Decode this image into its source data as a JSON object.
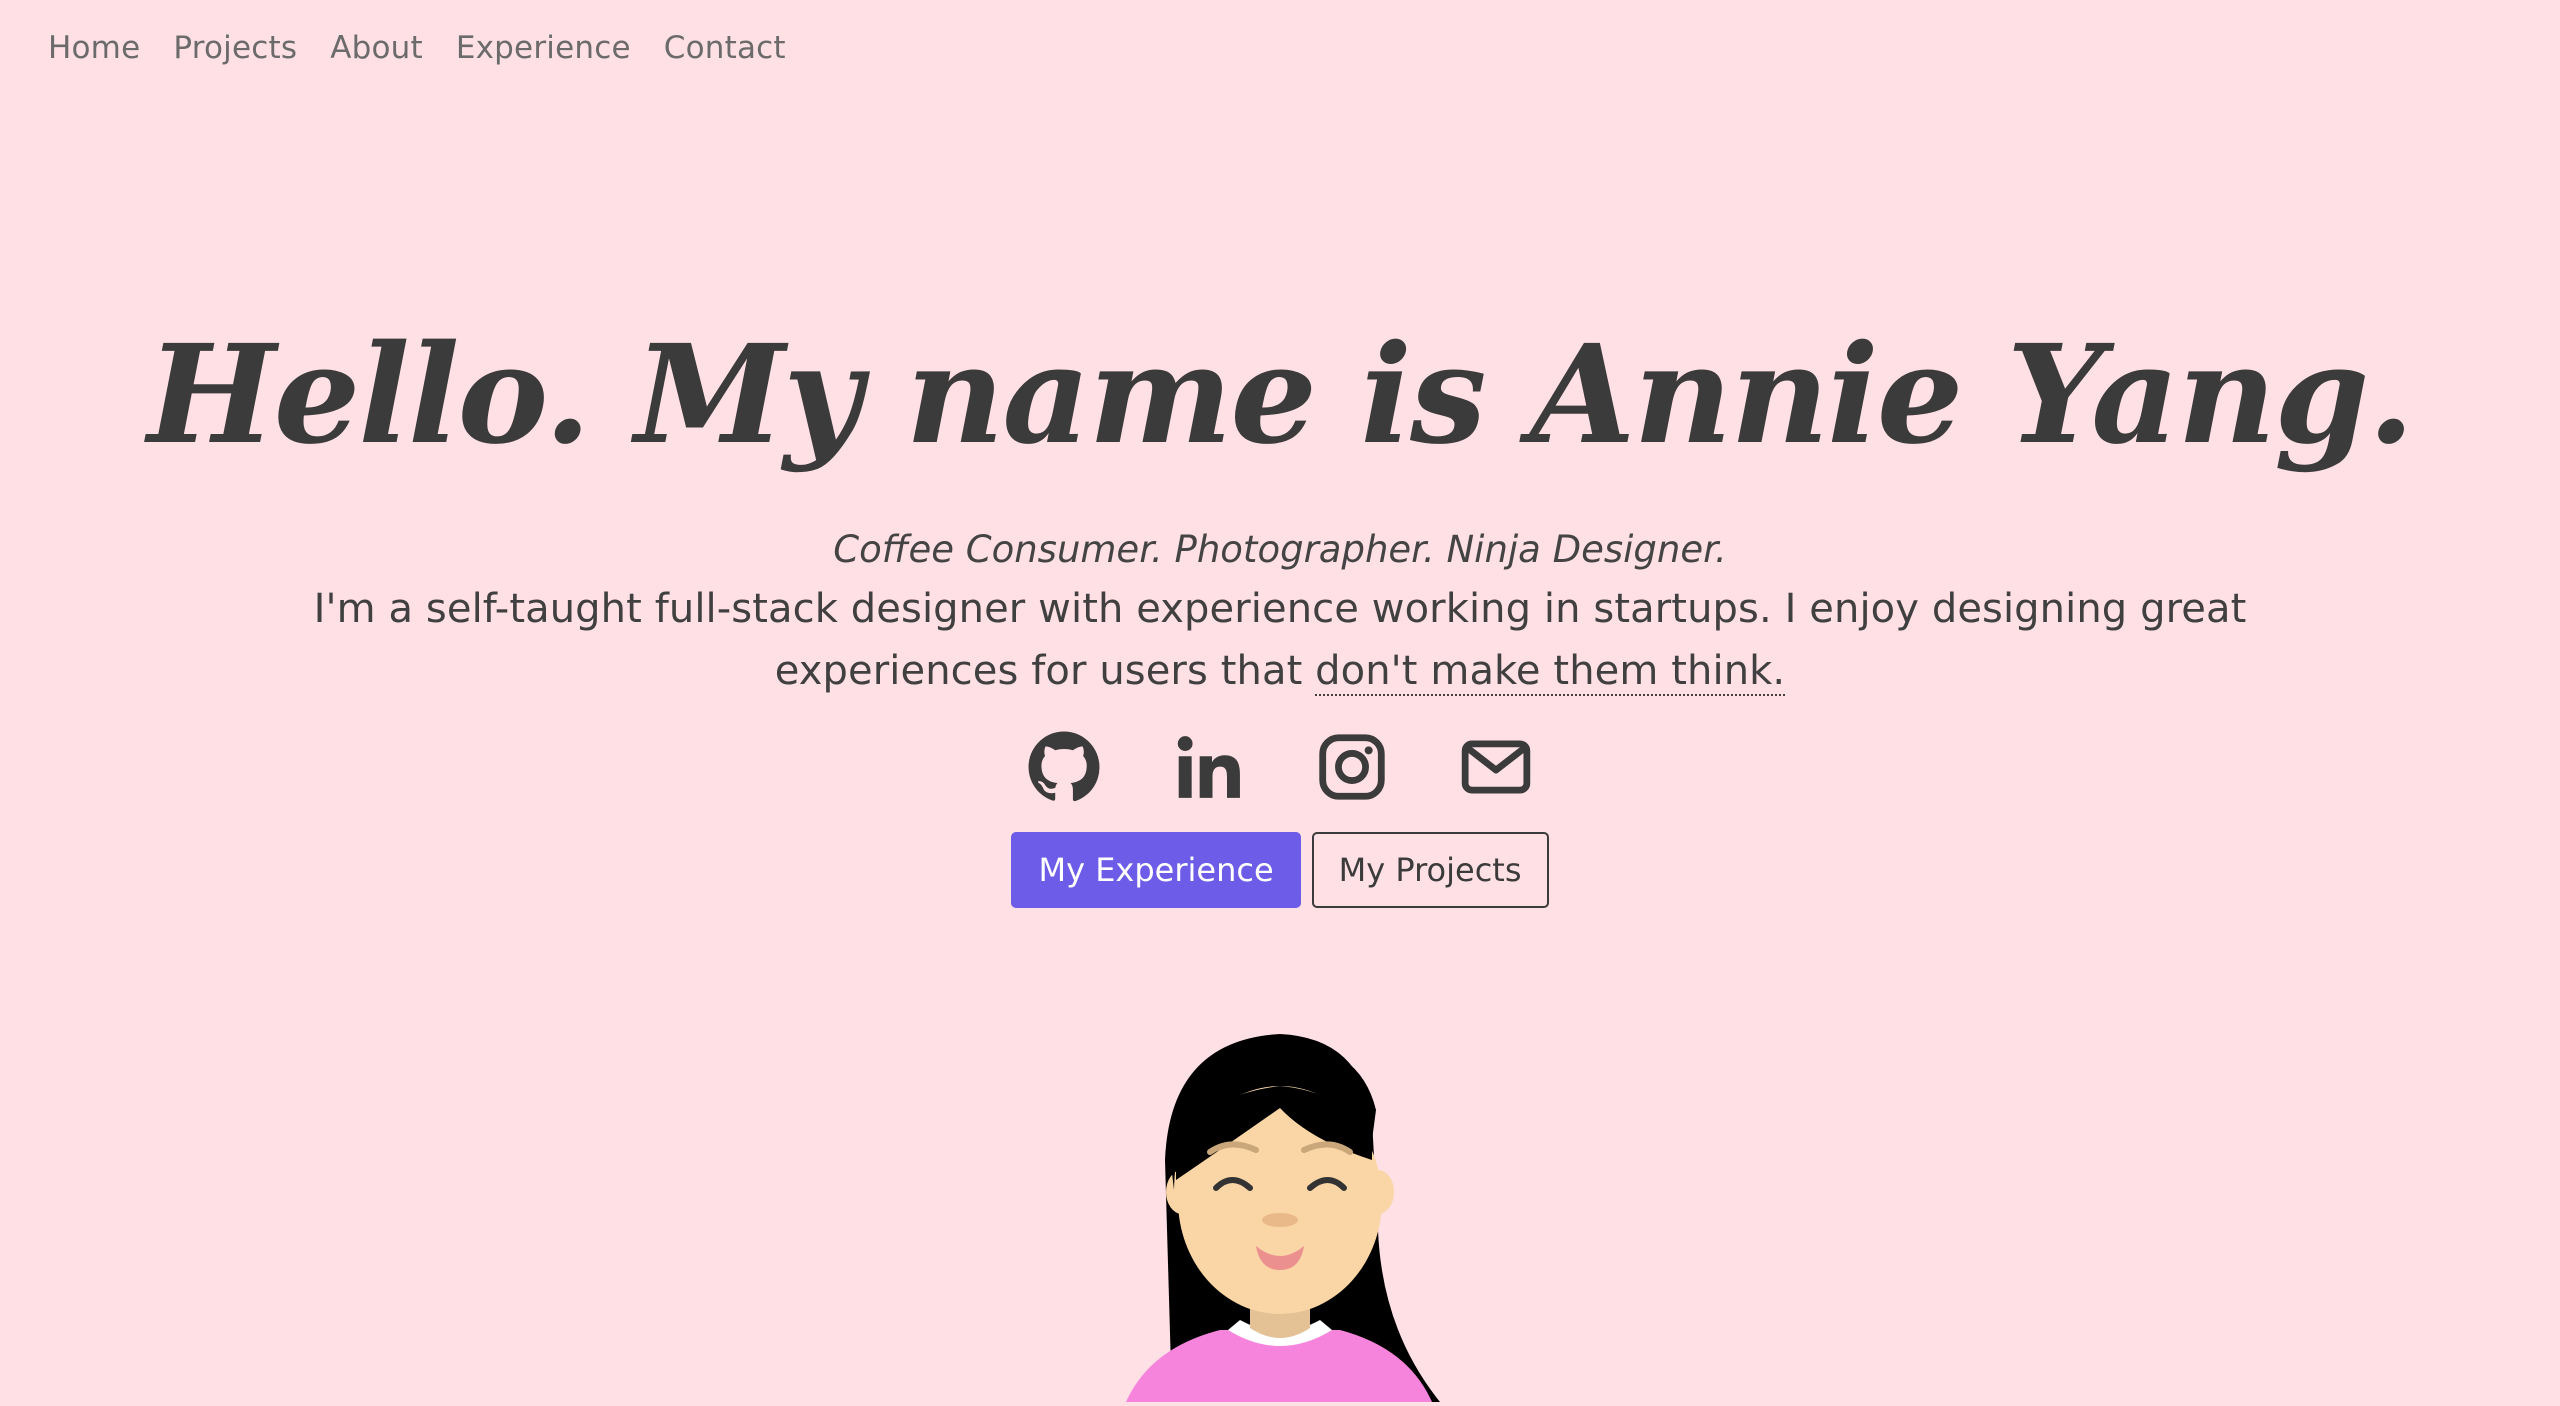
{
  "nav": {
    "items": [
      "Home",
      "Projects",
      "About",
      "Experience",
      "Contact"
    ]
  },
  "hero": {
    "title": "Hello. My name is Annie Yang.",
    "tagline": "Coffee Consumer. Photographer. Ninja Designer.",
    "intro_before": "I'm a self-taught full-stack designer with experience working in startups. I enjoy designing great experiences for users that ",
    "intro_link": "don't make them think."
  },
  "socials": [
    "github-icon",
    "linkedin-icon",
    "instagram-icon",
    "email-icon"
  ],
  "buttons": {
    "primary": "My Experience",
    "secondary": "My Projects"
  },
  "colors": {
    "background": "#ffe0e5",
    "text": "#3f3f3f",
    "accent": "#6c5ce7",
    "shirt": "#f784dc"
  }
}
